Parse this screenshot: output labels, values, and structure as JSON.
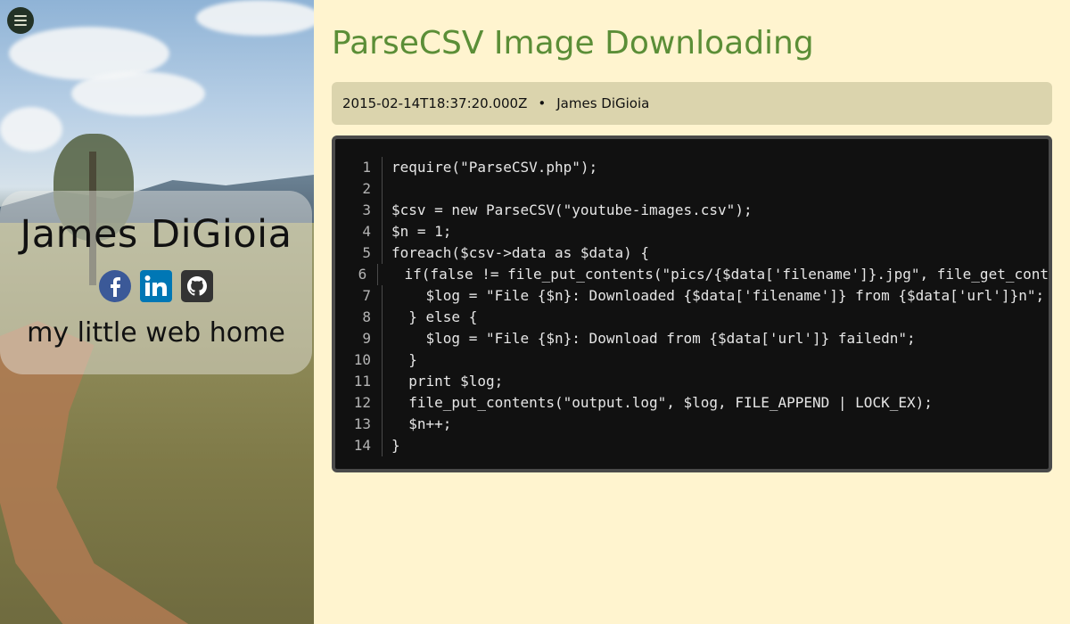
{
  "sidebar": {
    "name": "James DiGioia",
    "tagline": "my little web home",
    "social": [
      {
        "name": "facebook",
        "icon": "facebook-icon",
        "color": "#3b5998"
      },
      {
        "name": "linkedin",
        "icon": "linkedin-icon",
        "color": "#0077b5"
      },
      {
        "name": "github",
        "icon": "github-icon",
        "color": "#333333"
      }
    ]
  },
  "post": {
    "title": "ParseCSV Image Downloading",
    "date": "2015-02-14T18:37:20.000Z",
    "separator": "•",
    "author": "James DiGioia"
  },
  "code": {
    "lines": [
      {
        "n": "1",
        "text": "require(\"ParseCSV.php\");"
      },
      {
        "n": "2",
        "text": ""
      },
      {
        "n": "3",
        "text": "$csv = new ParseCSV(\"youtube-images.csv\");"
      },
      {
        "n": "4",
        "text": "$n = 1;"
      },
      {
        "n": "5",
        "text": "foreach($csv->data as $data) {"
      },
      {
        "n": "6",
        "text": "  if(false != file_put_contents(\"pics/{$data['filename']}.jpg\", file_get_cont"
      },
      {
        "n": "7",
        "text": "    $log = \"File {$n}: Downloaded {$data['filename']} from {$data['url']}n\";"
      },
      {
        "n": "8",
        "text": "  } else {"
      },
      {
        "n": "9",
        "text": "    $log = \"File {$n}: Download from {$data['url']} failedn\";"
      },
      {
        "n": "10",
        "text": "  }"
      },
      {
        "n": "11",
        "text": "  print $log;"
      },
      {
        "n": "12",
        "text": "  file_put_contents(\"output.log\", $log, FILE_APPEND | LOCK_EX);"
      },
      {
        "n": "13",
        "text": "  $n++;"
      },
      {
        "n": "14",
        "text": "}"
      }
    ]
  },
  "colors": {
    "accent": "#5b8e37",
    "page_bg": "#fff4cf",
    "meta_bg": "#dbd4ad",
    "code_bg": "#111111"
  }
}
